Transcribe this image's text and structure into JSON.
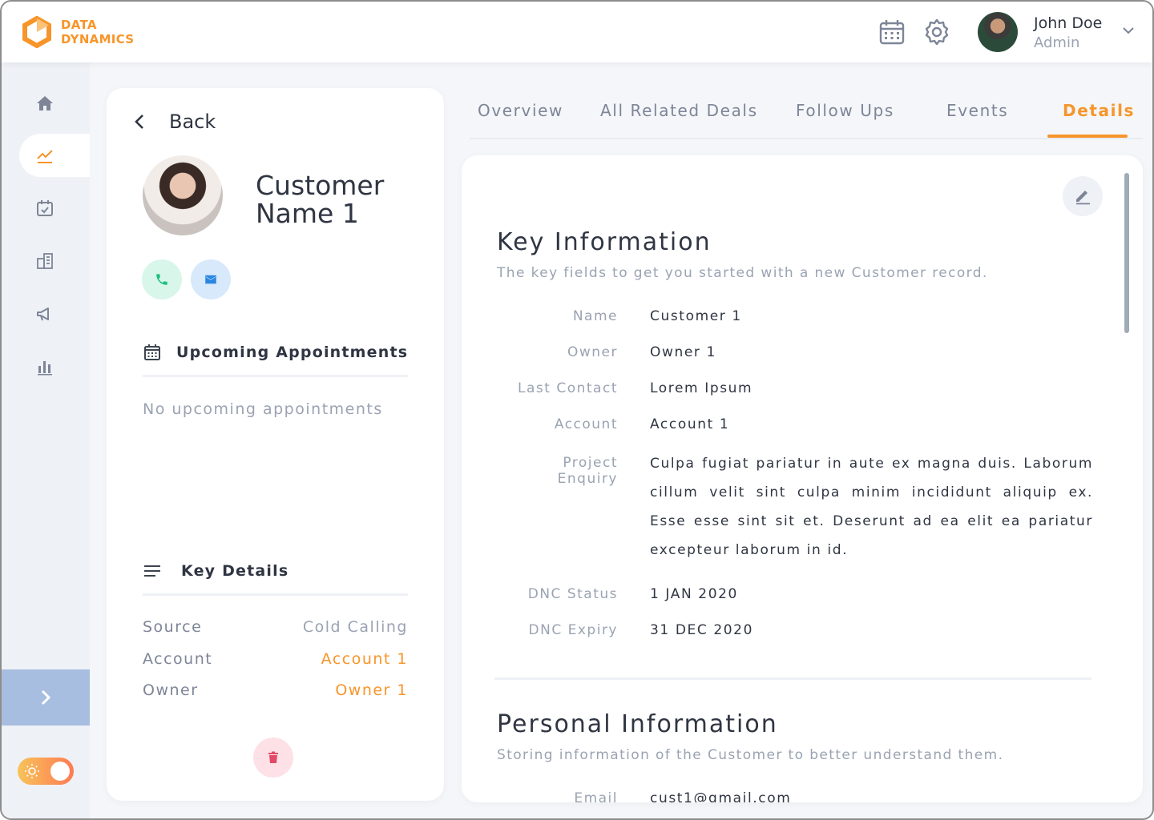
{
  "brand": {
    "line1": "DATA",
    "line2": "DYNAMICS",
    "accent": "#f7952a"
  },
  "header": {
    "calendar_icon": "calendar-icon",
    "settings_icon": "gear-icon",
    "user": {
      "name": "John Doe",
      "role": "Admin"
    }
  },
  "sidebar": {
    "items": [
      {
        "icon": "home-icon"
      },
      {
        "icon": "trend-chart-icon",
        "active": true
      },
      {
        "icon": "calendar-check-icon"
      },
      {
        "icon": "buildings-icon"
      },
      {
        "icon": "megaphone-icon"
      },
      {
        "icon": "bar-chart-icon"
      }
    ]
  },
  "customer": {
    "back_label": "Back",
    "name": "Customer Name 1",
    "upcoming_title": "Upcoming Appointments",
    "no_appointments": "No upcoming appointments",
    "key_details_title": "Key Details",
    "key_details": [
      {
        "label": "Source",
        "value": "Cold Calling"
      },
      {
        "label": "Account",
        "value": "Account 1"
      },
      {
        "label": "Owner",
        "value": "Owner 1"
      }
    ]
  },
  "tabs": [
    {
      "label": "Overview"
    },
    {
      "label": "All Related Deals"
    },
    {
      "label": "Follow Ups"
    },
    {
      "label": "Events"
    },
    {
      "label": "Details",
      "active": true
    }
  ],
  "details": {
    "key_info": {
      "title": "Key Information",
      "subtitle": "The key fields to get you started with a new Customer record.",
      "fields": [
        {
          "label": "Name",
          "value": "Customer 1"
        },
        {
          "label": "Owner",
          "value": "Owner 1"
        },
        {
          "label": "Last Contact",
          "value": "Lorem Ipsum"
        },
        {
          "label": "Account",
          "value": "Account 1"
        },
        {
          "label": "Project Enquiry",
          "value": "Culpa fugiat pariatur in aute ex magna duis. Laborum cillum velit sint culpa minim incididunt aliquip ex. Esse esse sint sit et. Deserunt ad ea elit ea pariatur excepteur laborum in id."
        },
        {
          "label": "DNC Status",
          "value": "1 JAN 2020"
        },
        {
          "label": "DNC Expiry",
          "value": "31 DEC 2020"
        }
      ]
    },
    "personal_info": {
      "title": "Personal Information",
      "subtitle": "Storing information of the Customer to better understand them.",
      "fields": [
        {
          "label": "Email",
          "value": "cust1@gmail.com"
        }
      ]
    }
  }
}
